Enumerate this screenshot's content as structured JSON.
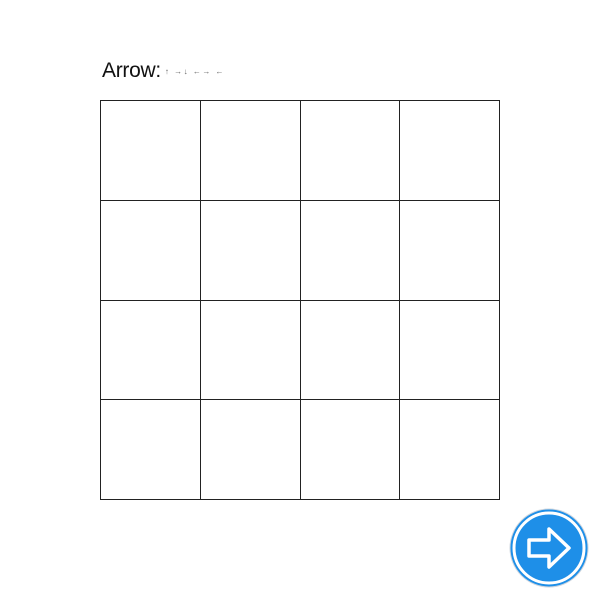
{
  "instruction": {
    "label": "Arrow:",
    "sequence": "↑ →↓ ←→ ←"
  },
  "grid": {
    "rows": 4,
    "columns": 4
  },
  "next_button": {
    "icon": "right-arrow-icon",
    "color": "#1e8fe8",
    "ring_color": "#ffffff"
  },
  "colors": {
    "grid_line": "#222222",
    "background": "#ffffff"
  }
}
